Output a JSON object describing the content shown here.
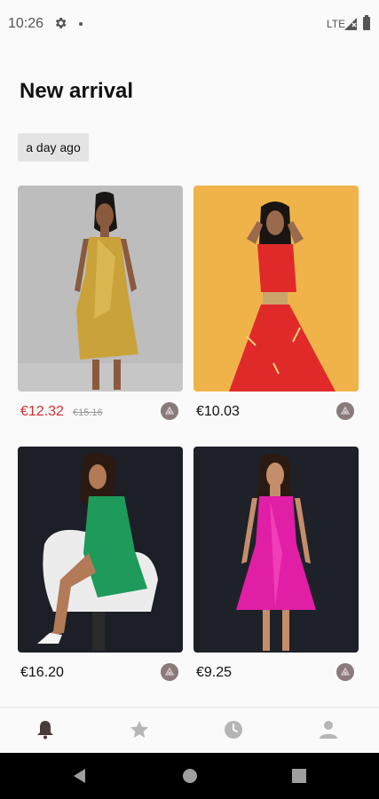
{
  "status_bar": {
    "time": "10:26",
    "network": "LTE"
  },
  "header": {
    "title": "New arrival"
  },
  "section": {
    "date_label": "a day ago"
  },
  "products": [
    {
      "price": "€12.32",
      "old_price": "€15.16",
      "on_sale": true,
      "dress_color": "#c9a23a",
      "background": "#bdbdbd"
    },
    {
      "price": "€10.03",
      "on_sale": false,
      "dress_color": "#e02a2a",
      "background": "#f0b34a"
    },
    {
      "price": "€16.20",
      "on_sale": false,
      "dress_color": "#1e9a5a",
      "background": "#1c1f26"
    },
    {
      "price": "€9.25",
      "on_sale": false,
      "dress_color": "#e01ea6",
      "background": "#1f2128"
    }
  ],
  "bottom_nav": {
    "items": [
      {
        "icon": "bell-icon",
        "active": true
      },
      {
        "icon": "star-icon",
        "active": false
      },
      {
        "icon": "clock-icon",
        "active": false
      },
      {
        "icon": "person-icon",
        "active": false
      }
    ]
  },
  "colors": {
    "accent_sale": "#d32f2f",
    "chip_background": "#e4e4e4",
    "nav_inactive": "#b5b5b5",
    "nav_active": "#4a3b3b"
  }
}
